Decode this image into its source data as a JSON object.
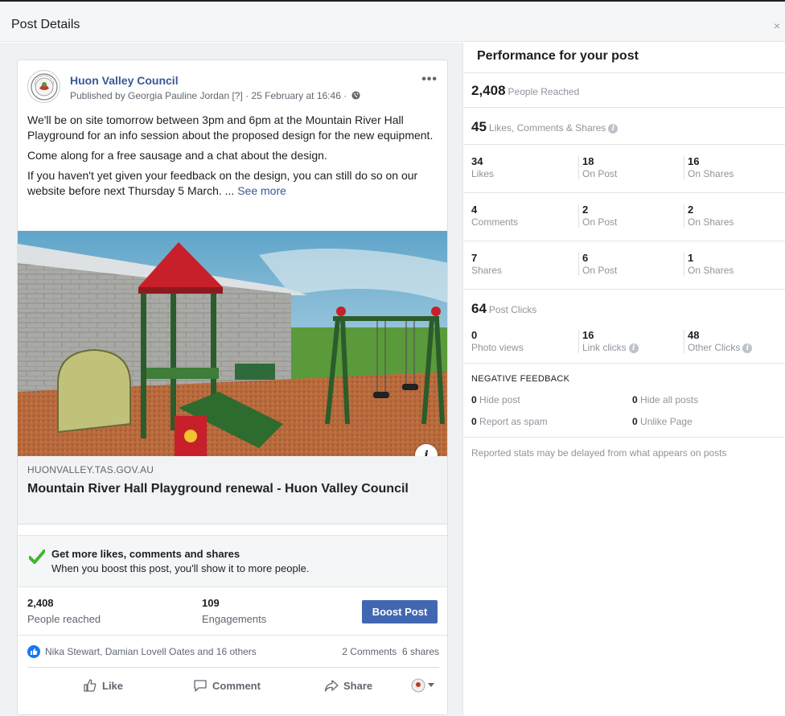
{
  "dialog": {
    "title": "Post Details",
    "close_label": "×"
  },
  "post": {
    "page_name": "Huon Valley Council",
    "published_by": "Published by Georgia Pauline Jordan [?] · 25 February at 16:46 ·",
    "more_label": "•••",
    "paragraphs": [
      "We'll be on site tomorrow between 3pm and 6pm at the Mountain River Hall Playground for an info session about the proposed design for the new equipment.",
      "Come along for a free sausage and a chat about the design.",
      "If you haven't yet given your feedback on the design, you can still do so on our website before next Thursday 5 March. ..."
    ],
    "see_more": "See more",
    "link_domain": "HUONVALLEY.TAS.GOV.AU",
    "link_title": "Mountain River Hall Playground renewal - Huon Valley Council",
    "info_label": "i"
  },
  "promo": {
    "title": "Get more likes, comments and shares",
    "subtitle": "When you boost this post, you'll show it to more people."
  },
  "summary": {
    "reached_value": "2,408",
    "reached_label": "People reached",
    "engagements_value": "109",
    "engagements_label": "Engagements",
    "boost_label": "Boost Post"
  },
  "reactions": {
    "names": "Nika Stewart, Damian Lovell Oates and 16 others",
    "comments": "2 Comments",
    "shares": "6 shares"
  },
  "actions": {
    "like": "Like",
    "comment": "Comment",
    "share": "Share"
  },
  "performance": {
    "title": "Performance for your post",
    "reached_value": "2,408",
    "reached_label": "People Reached",
    "engagement_value": "45",
    "engagement_label": "Likes, Comments & Shares",
    "likes": {
      "value": "34",
      "label": "Likes",
      "on_post_value": "18",
      "on_post_label": "On Post",
      "on_shares_value": "16",
      "on_shares_label": "On Shares"
    },
    "comments": {
      "value": "4",
      "label": "Comments",
      "on_post_value": "2",
      "on_post_label": "On Post",
      "on_shares_value": "2",
      "on_shares_label": "On Shares"
    },
    "shares": {
      "value": "7",
      "label": "Shares",
      "on_post_value": "6",
      "on_post_label": "On Post",
      "on_shares_value": "1",
      "on_shares_label": "On Shares"
    },
    "clicks_value": "64",
    "clicks_label": "Post Clicks",
    "photo_views_value": "0",
    "photo_views_label": "Photo views",
    "link_clicks_value": "16",
    "link_clicks_label": "Link clicks",
    "other_clicks_value": "48",
    "other_clicks_label": "Other Clicks",
    "negative_title": "NEGATIVE FEEDBACK",
    "hide_post_value": "0",
    "hide_post_label": "Hide post",
    "hide_all_value": "0",
    "hide_all_label": "Hide all posts",
    "spam_value": "0",
    "spam_label": "Report as spam",
    "unlike_value": "0",
    "unlike_label": "Unlike Page",
    "note": "Reported stats may be delayed from what appears on posts"
  },
  "colors": {
    "link_blue": "#385898",
    "button_blue": "#4267b2",
    "check_green": "#42b72a"
  }
}
